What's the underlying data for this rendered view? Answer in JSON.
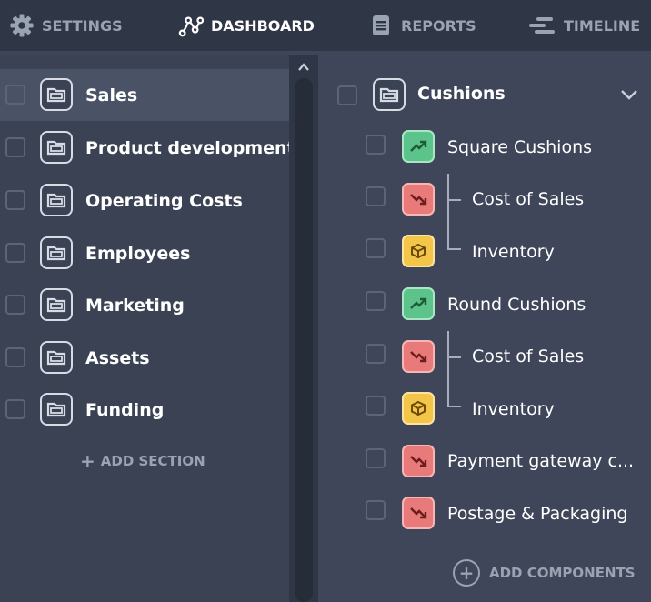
{
  "nav": {
    "settings": "SETTINGS",
    "dashboard": "DASHBOARD",
    "reports": "REPORTS",
    "timeline": "TIMELINE",
    "active": "dashboard"
  },
  "sections": [
    {
      "label": "Sales",
      "selected": true
    },
    {
      "label": "Product development",
      "selected": false
    },
    {
      "label": "Operating Costs",
      "selected": false
    },
    {
      "label": "Employees",
      "selected": false
    },
    {
      "label": "Marketing",
      "selected": false
    },
    {
      "label": "Assets",
      "selected": false
    },
    {
      "label": "Funding",
      "selected": false
    }
  ],
  "add_section": "ADD SECTION",
  "detail": {
    "title": "Cushions",
    "components": [
      {
        "label": "Square Cushions",
        "type": "trend-up",
        "color": "green",
        "child": false
      },
      {
        "label": "Cost of Sales",
        "type": "trend-down",
        "color": "red",
        "child": true
      },
      {
        "label": "Inventory",
        "type": "box",
        "color": "yellow",
        "child": true
      },
      {
        "label": "Round Cushions",
        "type": "trend-up",
        "color": "green",
        "child": false
      },
      {
        "label": "Cost of Sales",
        "type": "trend-down",
        "color": "red",
        "child": true
      },
      {
        "label": "Inventory",
        "type": "box",
        "color": "yellow",
        "child": true
      },
      {
        "label": "Payment gateway c...",
        "type": "trend-down",
        "color": "red",
        "child": false
      },
      {
        "label": "Postage & Packaging",
        "type": "trend-down",
        "color": "red",
        "child": false
      }
    ],
    "add_components": "ADD COMPONENTS"
  },
  "colors": {
    "nav_bg": "#2f3645",
    "panel_bg": "#3a4254",
    "selected_row": "#4a5266",
    "green": "#5cc48a",
    "red": "#e97a7a",
    "yellow": "#f3c64a"
  }
}
